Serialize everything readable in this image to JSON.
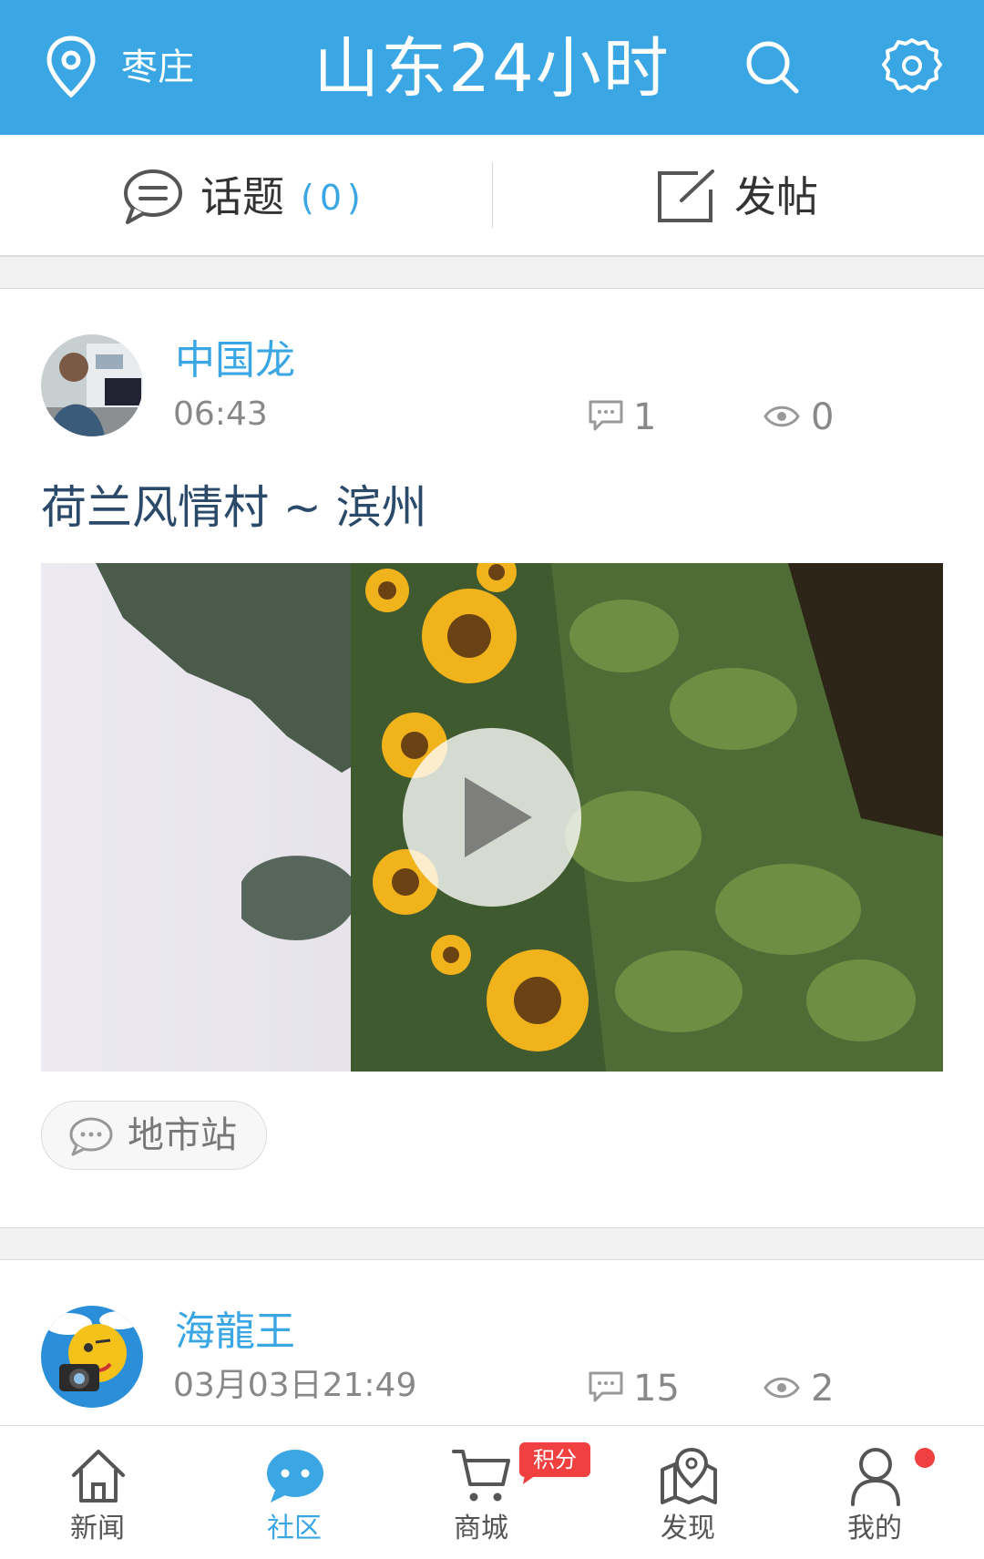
{
  "header": {
    "location": "枣庄",
    "title": "山东24小时",
    "icons": [
      "location-pin-icon",
      "search-icon",
      "settings-gear-icon"
    ]
  },
  "actions": {
    "topic_label": "话题",
    "topic_count": "(0)",
    "post_label": "发帖"
  },
  "posts": [
    {
      "username": "中国龙",
      "time": "06:43",
      "comments": "1",
      "views": "0",
      "title": "荷兰风情村 ~ 滨州",
      "tag": "地市站"
    },
    {
      "username": "海龍王",
      "time": "03月03日21:49",
      "comments": "15",
      "views": "2"
    }
  ],
  "nav": {
    "items": [
      {
        "label": "新闻",
        "icon": "home-icon"
      },
      {
        "label": "社区",
        "icon": "chat-bubble-icon"
      },
      {
        "label": "商城",
        "icon": "cart-icon"
      },
      {
        "label": "发现",
        "icon": "map-pin-icon"
      },
      {
        "label": "我的",
        "icon": "user-icon"
      }
    ],
    "active_index": 1,
    "badge": "积分"
  },
  "colors": {
    "accent": "#3aa7e4",
    "badge": "#f04040",
    "title_text": "#2b4a6a"
  }
}
